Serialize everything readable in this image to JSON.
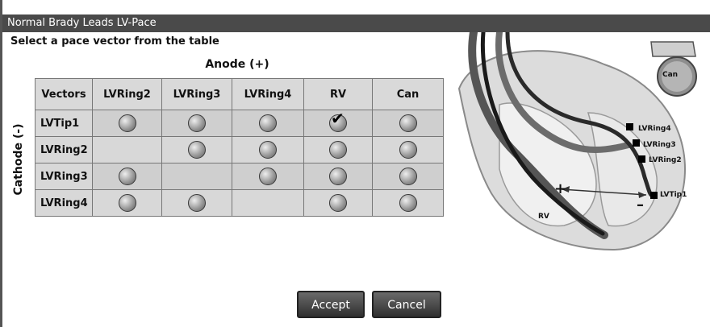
{
  "window": {
    "title": "Normal Brady Leads LV-Pace"
  },
  "instruction": "Select a pace vector from the table",
  "anode_label": "Anode (+)",
  "cathode_label": "Cathode (-)",
  "table": {
    "corner": "Vectors",
    "columns": [
      "LVRing2",
      "LVRing3",
      "LVRing4",
      "RV",
      "Can"
    ],
    "rows": [
      {
        "label": "LVTip1",
        "cells": [
          "radio",
          "radio",
          "radio",
          "selected",
          "radio"
        ]
      },
      {
        "label": "LVRing2",
        "cells": [
          "",
          "radio",
          "radio",
          "radio",
          "radio"
        ]
      },
      {
        "label": "LVRing3",
        "cells": [
          "radio",
          "",
          "radio",
          "radio",
          "radio"
        ]
      },
      {
        "label": "LVRing4",
        "cells": [
          "radio",
          "radio",
          "",
          "radio",
          "radio"
        ]
      }
    ]
  },
  "diagram": {
    "can": "Can",
    "lvring4": "LVRing4",
    "lvring3": "LVRing3",
    "lvring2": "LVRing2",
    "lvtip1": "LVTip1",
    "rv": "RV",
    "plus": "+",
    "minus": "–"
  },
  "buttons": {
    "accept": "Accept",
    "cancel": "Cancel"
  }
}
